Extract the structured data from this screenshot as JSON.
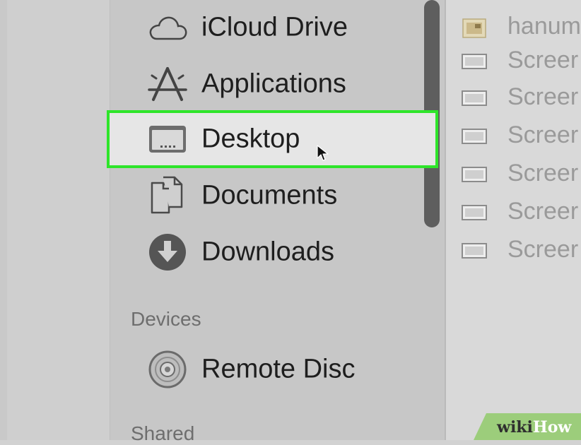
{
  "sidebar": {
    "favorites": [
      {
        "label": "iCloud Drive",
        "icon": "cloud-icon"
      },
      {
        "label": "Applications",
        "icon": "applications-icon"
      },
      {
        "label": "Desktop",
        "icon": "desktop-icon",
        "selected": true
      },
      {
        "label": "Documents",
        "icon": "documents-icon"
      },
      {
        "label": "Downloads",
        "icon": "downloads-icon"
      }
    ],
    "devices_title": "Devices",
    "devices": [
      {
        "label": "Remote Disc",
        "icon": "disc-icon"
      }
    ],
    "shared_title": "Shared"
  },
  "files": [
    {
      "name": "hanum",
      "icon": "image-file-icon"
    },
    {
      "name": "Screer",
      "icon": "screenshot-file-icon"
    },
    {
      "name": "Screer",
      "icon": "screenshot-file-icon"
    },
    {
      "name": "Screer",
      "icon": "screenshot-file-icon"
    },
    {
      "name": "Screer",
      "icon": "screenshot-file-icon"
    },
    {
      "name": "Screer",
      "icon": "screenshot-file-icon"
    },
    {
      "name": "Screer",
      "icon": "screenshot-file-icon"
    }
  ],
  "watermark": {
    "wiki": "wiki",
    "how": "How"
  },
  "colors": {
    "highlight_border": "#2ee52a",
    "selected_bg": "#e6e6e6",
    "watermark_bg": "#9ccd7b"
  }
}
